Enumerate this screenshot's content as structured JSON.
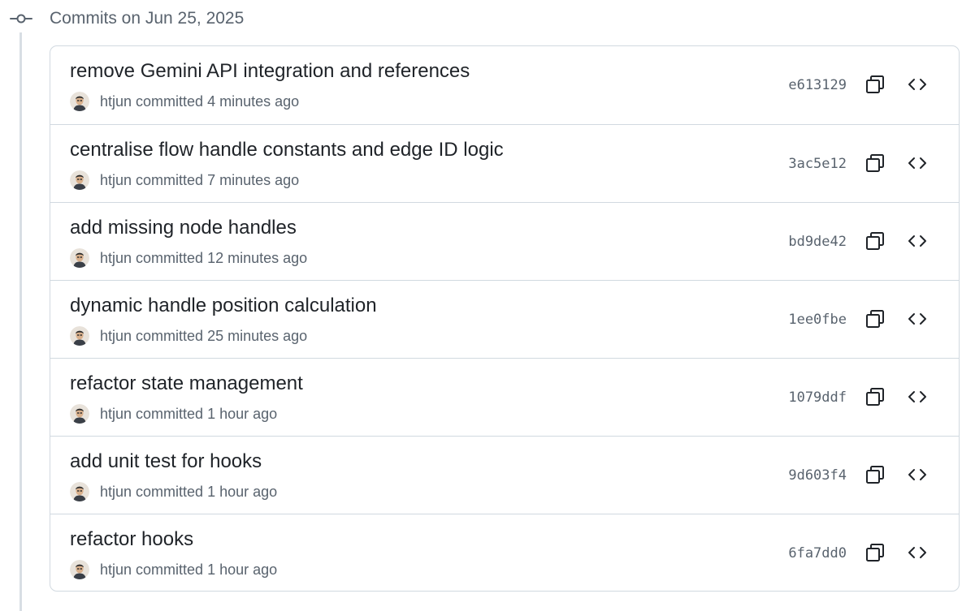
{
  "group": {
    "title": "Commits on Jun 25, 2025",
    "icon": "git-commit-icon"
  },
  "colors": {
    "text_primary": "#1f2328",
    "text_muted": "#59636e",
    "border": "#d1d9e0",
    "timeline": "#d8dee4"
  },
  "commits": [
    {
      "message": "remove Gemini API integration and references",
      "author": "htjun",
      "action": "committed",
      "time": "4 minutes ago",
      "sha": "e613129"
    },
    {
      "message": "centralise flow handle constants and edge ID logic",
      "author": "htjun",
      "action": "committed",
      "time": "7 minutes ago",
      "sha": "3ac5e12"
    },
    {
      "message": "add missing node handles",
      "author": "htjun",
      "action": "committed",
      "time": "12 minutes ago",
      "sha": "bd9de42"
    },
    {
      "message": "dynamic handle position calculation",
      "author": "htjun",
      "action": "committed",
      "time": "25 minutes ago",
      "sha": "1ee0fbe"
    },
    {
      "message": "refactor state management",
      "author": "htjun",
      "action": "committed",
      "time": "1 hour ago",
      "sha": "1079ddf"
    },
    {
      "message": "add unit test for hooks",
      "author": "htjun",
      "action": "committed",
      "time": "1 hour ago",
      "sha": "9d603f4"
    },
    {
      "message": "refactor hooks",
      "author": "htjun",
      "action": "committed",
      "time": "1 hour ago",
      "sha": "6fa7dd0"
    }
  ],
  "row_icons": {
    "copy": "copy-icon",
    "browse": "code-icon"
  }
}
